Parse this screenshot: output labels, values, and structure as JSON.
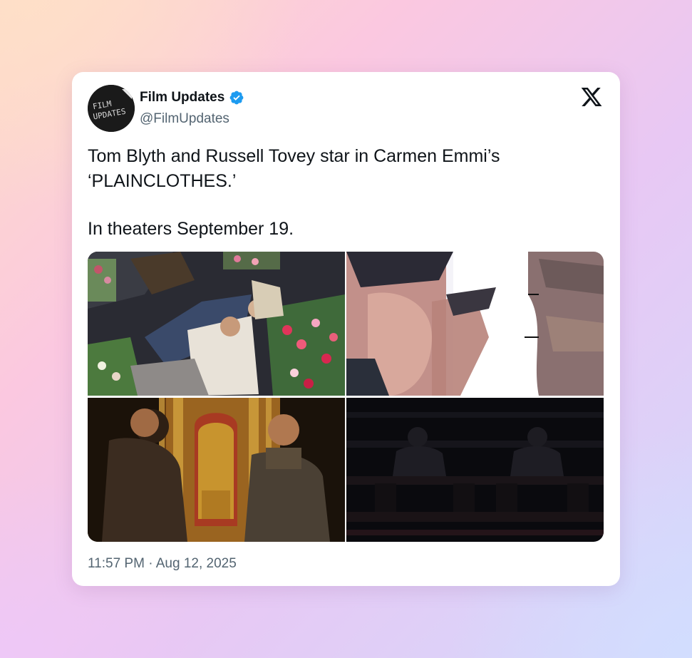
{
  "tweet": {
    "display_name": "Film Updates",
    "handle": "@FilmUpdates",
    "verified": true,
    "avatar_text": [
      "FILM",
      "UPDATES"
    ],
    "text_lines": [
      "Tom Blyth and Russell Tovey star in Carmen Emmi’s",
      "‘PLAINCLOTHES.’",
      "In theaters September 19."
    ],
    "time": "11:57 PM",
    "separator": "·",
    "date": "Aug 12, 2025",
    "timestamp": "11:57 PM · Aug 12, 2025"
  },
  "icons": {
    "verified": "verified-badge-icon",
    "platform": "x-logo-icon"
  },
  "media": [
    {
      "description_name": "still-two-men-lying-among-flowers"
    },
    {
      "description_name": "still-close-up-faces-overexposed"
    },
    {
      "description_name": "still-two-men-face-to-face-ornate-room"
    },
    {
      "description_name": "still-dark-theater-silhouettes"
    }
  ],
  "colors": {
    "verified_blue": "#1d9bf0",
    "text_primary": "#0f1419",
    "text_secondary": "#536471",
    "card_bg": "#ffffff"
  }
}
